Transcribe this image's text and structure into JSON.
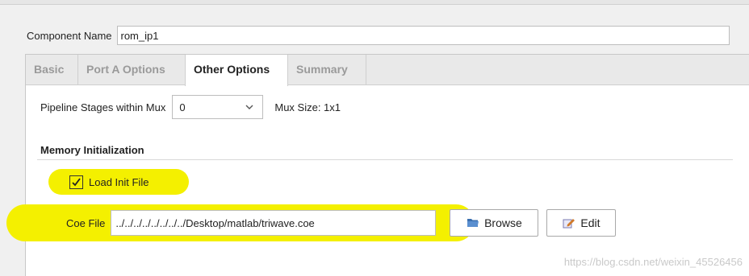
{
  "component": {
    "label": "Component Name",
    "value": "rom_ip1"
  },
  "tabs": [
    {
      "label": "Basic"
    },
    {
      "label": "Port A Options"
    },
    {
      "label": "Other Options"
    },
    {
      "label": "Summary"
    }
  ],
  "active_tab": "Other Options",
  "pipeline": {
    "label": "Pipeline Stages within Mux",
    "selected": "0",
    "mux_size": "Mux Size: 1x1"
  },
  "memory_init": {
    "title": "Memory Initialization",
    "load_label": "Load Init File",
    "load_checked": true,
    "coe_label": "Coe File",
    "coe_value": "../../../../../../../../Desktop/matlab/triwave.coe",
    "browse_label": "Browse",
    "edit_label": "Edit"
  },
  "watermark": "https://blog.csdn.net/weixin_45526456",
  "colors": {
    "highlight": "#f4f000",
    "active_tab_bg": "#ffffff",
    "tab_bar_bg": "#e9e9e9"
  },
  "icons": {
    "checkbox": "check-mark",
    "browse": "folder-icon",
    "edit": "edit-pencil-icon",
    "dropdown": "chevron-down-icon"
  }
}
